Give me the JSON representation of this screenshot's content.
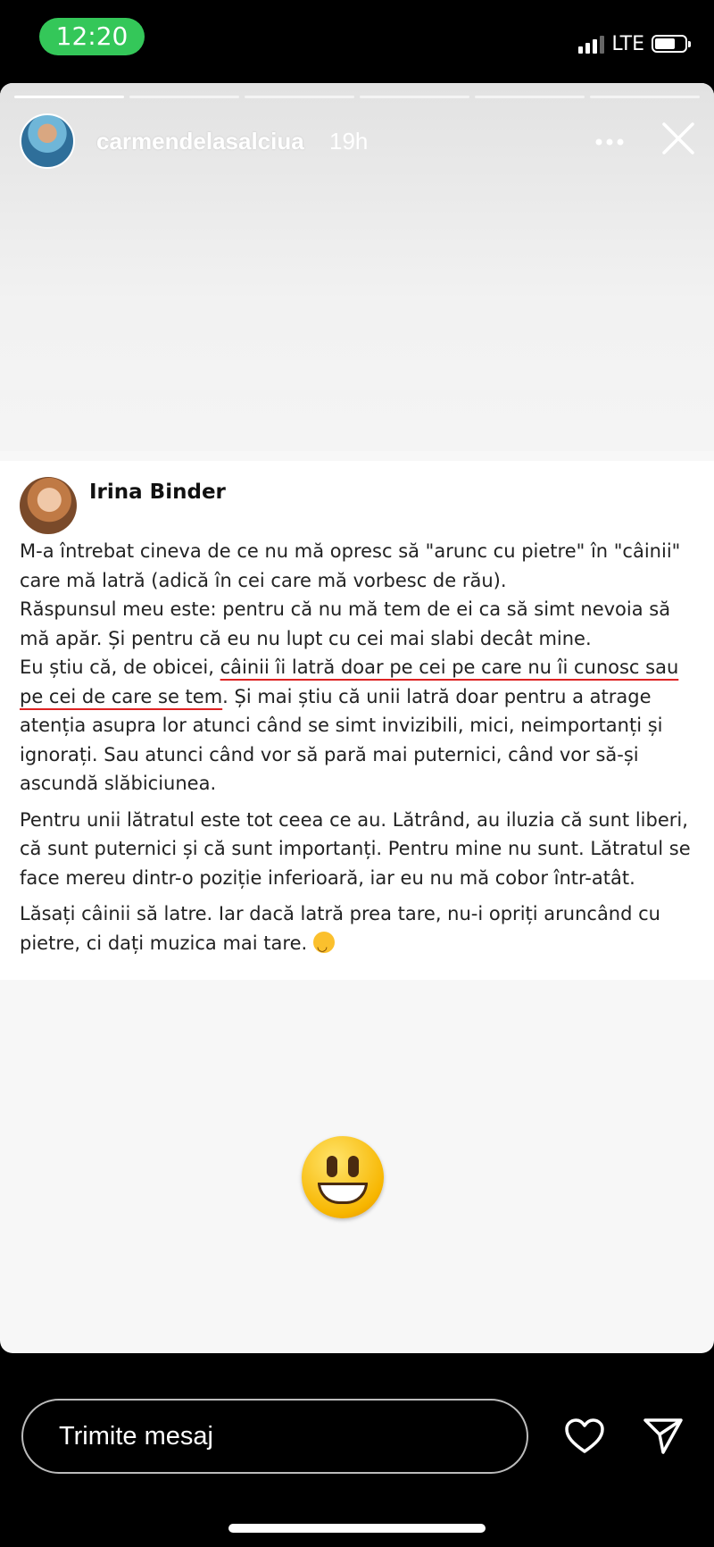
{
  "status_bar": {
    "time": "12:20",
    "network": "LTE"
  },
  "story": {
    "username": "carmendelasalciua",
    "time_ago": "19h",
    "progress_segments": 6,
    "active_segment": 1
  },
  "post": {
    "author": "Irina Binder",
    "p1_a": "M-a întrebat cineva de ce nu mă opresc să \"arunc cu pietre\" în \"câinii\" care mă latră (adică în cei care mă vorbesc de rău).",
    "p1_b": "Răspunsul meu este: pentru că nu mă tem de ei ca să simt nevoia să mă apăr. Și pentru că eu nu lupt cu cei mai slabi decât mine.",
    "p1_c1": "Eu știu că, de obicei, ",
    "p1_c_underlined": "câinii îi latră doar pe cei pe care nu îi cunosc sau pe cei de care se tem",
    "p1_c2": ". Și mai știu că unii latră doar pentru a atrage atenția asupra lor atunci când se simt invizibili, mici, neimportanți și ignorați. Sau atunci când vor să pară mai puternici, când vor să-și ascundă slăbiciunea.",
    "p2": "Pentru unii lătratul este tot ceea ce au. Lătrând, au iluzia că sunt liberi, că sunt puternici și că sunt importanți. Pentru mine nu sunt. Lătratul se face mereu dintr-o poziție inferioară, iar eu nu mă cobor într-atât.",
    "p3": "Lăsați câinii să latre. Iar dacă latră prea tare, nu-i opriți aruncând cu pietre, ci dați muzica mai tare."
  },
  "footer": {
    "message_placeholder": "Trimite mesaj"
  },
  "icons": {
    "more": "more-icon",
    "close": "close-icon",
    "heart": "heart-icon",
    "send": "send-icon",
    "sticker": "smiley-emoji"
  },
  "colors": {
    "status_green": "#34c759",
    "underline_red": "#dd2222",
    "background": "#000000"
  }
}
